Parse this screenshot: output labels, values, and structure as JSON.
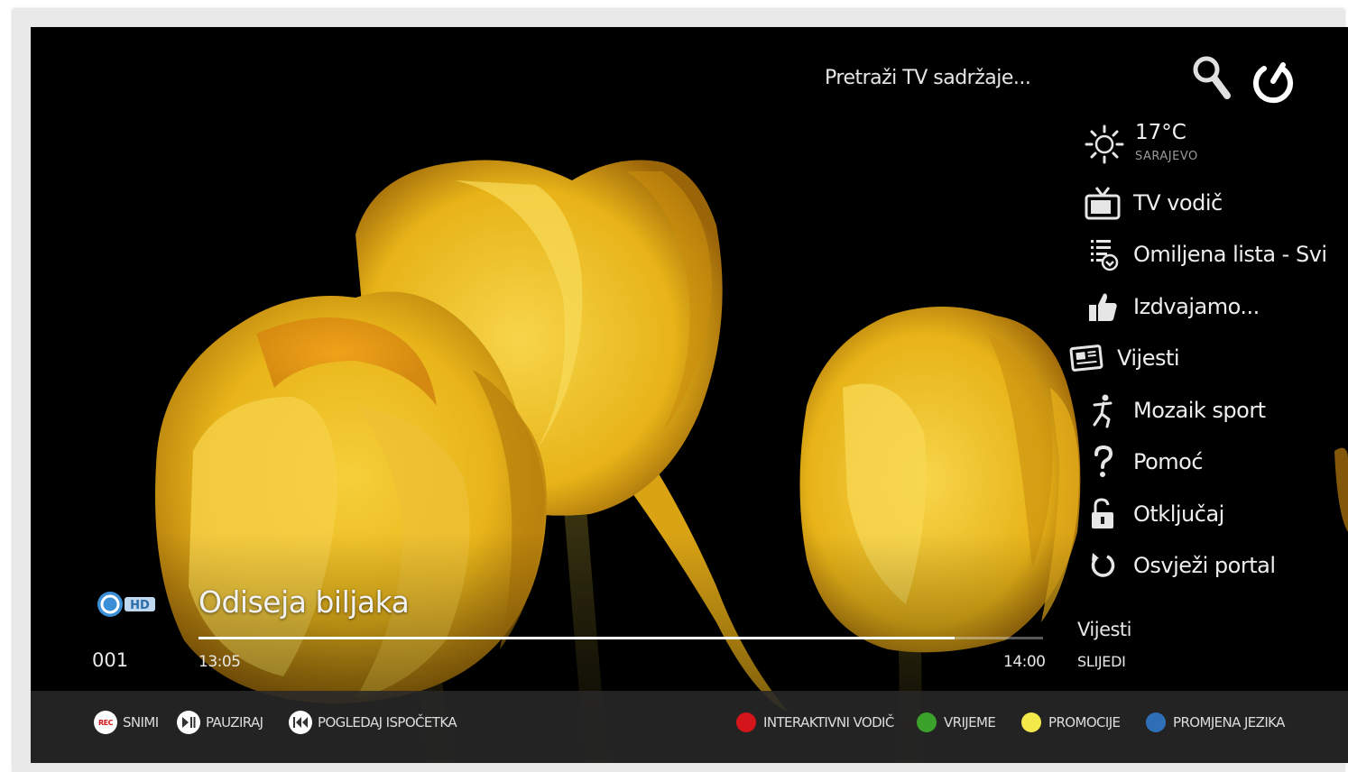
{
  "search": {
    "placeholder": "Pretraži TV sadržaje..."
  },
  "weather": {
    "temperature": "17°C",
    "city": "SARAJEVO",
    "icon": "sun-icon"
  },
  "menu": {
    "items": [
      {
        "label": "TV vodič",
        "icon": "tv-icon"
      },
      {
        "label": "Omiljena lista - Svi",
        "icon": "favorite-list-icon"
      },
      {
        "label": "Izdvajamo...",
        "icon": "thumbs-up-icon"
      },
      {
        "label": "Vijesti",
        "icon": "newspaper-icon"
      },
      {
        "label": "Mozaik sport",
        "icon": "sport-icon"
      },
      {
        "label": "Pomoć",
        "icon": "question-icon"
      },
      {
        "label": "Otključaj",
        "icon": "unlock-icon"
      },
      {
        "label": "Osvježi portal",
        "icon": "refresh-icon"
      }
    ]
  },
  "program": {
    "channel_number": "001",
    "channel_logo_text": "HD",
    "title": "Odiseja biljaka",
    "start_time": "13:05",
    "end_time": "14:00",
    "progress": 0.895,
    "next_title": "Vijesti",
    "next_label": "SLIJEDI"
  },
  "bottom_bar": {
    "rec_badge": "REC",
    "record_label": "SNIMI",
    "pause_label": "PAUZIRAJ",
    "restart_label": "POGLEDAJ ISPOČETKA",
    "red_label": "INTERAKTIVNI VODIČ",
    "green_label": "VRIJEME",
    "yellow_label": "PROMOCIJE",
    "blue_label": "PROMJENA JEZIKA",
    "colors": {
      "red": "#d4151b",
      "green": "#3aa22a",
      "yellow": "#f3e94a",
      "blue": "#2f6fb8"
    }
  }
}
